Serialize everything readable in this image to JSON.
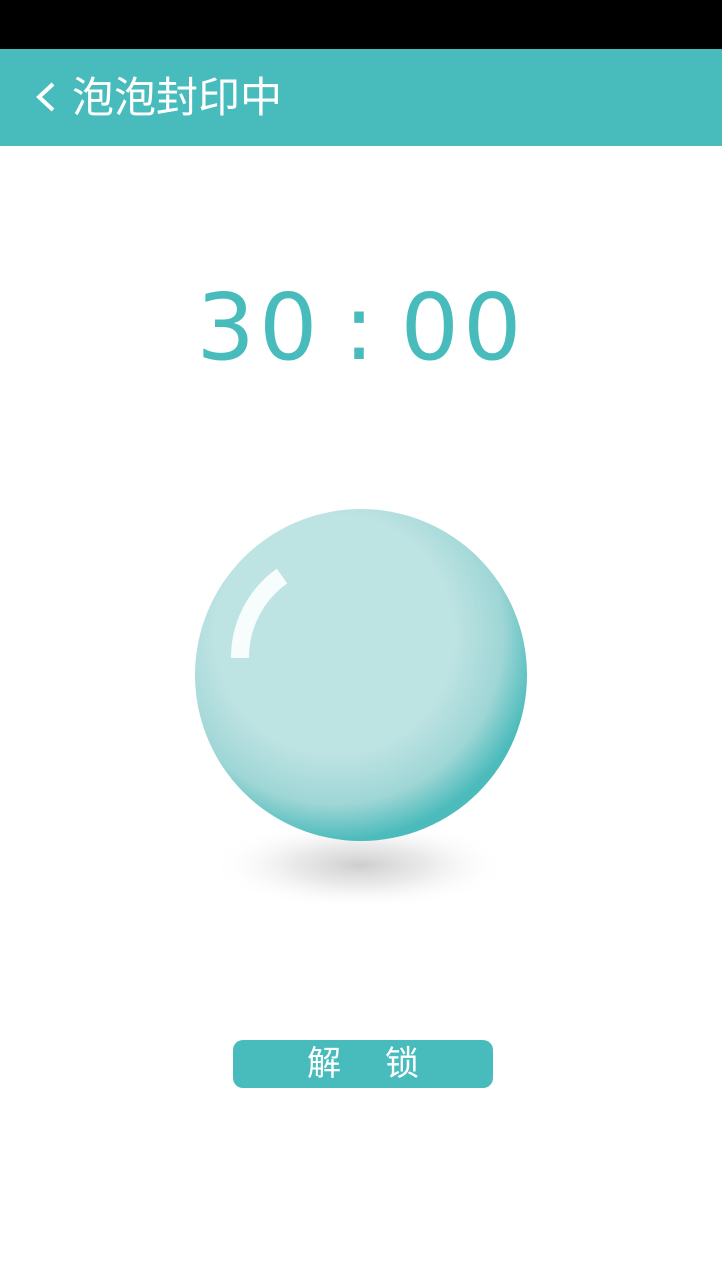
{
  "header": {
    "title": "泡泡封印中",
    "back_icon": "chevron-left-icon"
  },
  "timer": {
    "minutes": "30",
    "separator": ":",
    "seconds": "00"
  },
  "bubble": {
    "icon": "bubble-icon"
  },
  "actions": {
    "unlock_label": "解锁"
  },
  "colors": {
    "accent": "#48BCBC",
    "status_bar": "#000000",
    "background": "#FFFFFF",
    "bubble_fill": "#BEE3E3"
  }
}
